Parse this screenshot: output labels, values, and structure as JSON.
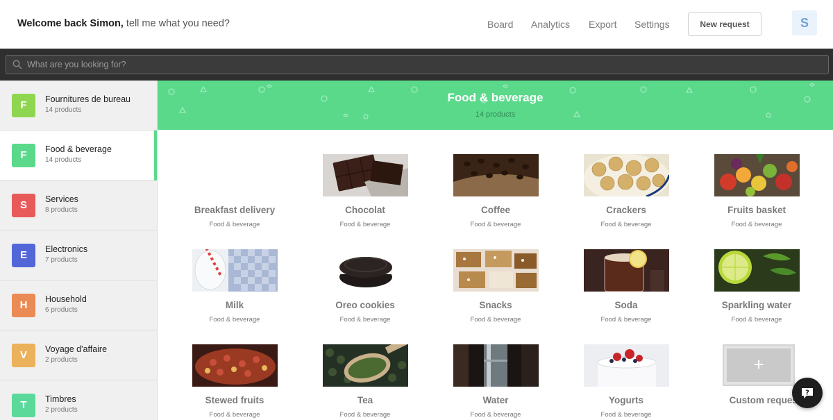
{
  "header": {
    "welcome_bold": "Welcome back Simon,",
    "welcome_rest": " tell me what you need?",
    "nav": [
      "Board",
      "Analytics",
      "Export",
      "Settings"
    ],
    "new_request_label": "New request",
    "avatar_initial": "S"
  },
  "search": {
    "placeholder": "What are you looking for?"
  },
  "sidebar": {
    "categories": [
      {
        "letter": "F",
        "name": "Fournitures de bureau",
        "count": "14 products",
        "color": "#8fd650",
        "active": false
      },
      {
        "letter": "F",
        "name": "Food & beverage",
        "count": "14 products",
        "color": "#5bd98b",
        "active": true
      },
      {
        "letter": "S",
        "name": "Services",
        "count": "8 products",
        "color": "#e85a5a",
        "active": false
      },
      {
        "letter": "E",
        "name": "Electronics",
        "count": "7 products",
        "color": "#5366d8",
        "active": false
      },
      {
        "letter": "H",
        "name": "Household",
        "count": "6 products",
        "color": "#ea8a55",
        "active": false
      },
      {
        "letter": "V",
        "name": "Voyage d'affaire",
        "count": "2 products",
        "color": "#ecb15b",
        "active": false
      },
      {
        "letter": "T",
        "name": "Timbres",
        "count": "2 products",
        "color": "#5bd99a",
        "active": false
      }
    ]
  },
  "banner": {
    "title": "Food & beverage",
    "subtitle": "14 products",
    "color": "#5bd98b"
  },
  "products": [
    {
      "name": "Breakfast delivery",
      "category": "Food & beverage",
      "image": "none"
    },
    {
      "name": "Chocolat",
      "category": "Food & beverage",
      "image": "chocolate-photo"
    },
    {
      "name": "Coffee",
      "category": "Food & beverage",
      "image": "coffee-beans-photo"
    },
    {
      "name": "Crackers",
      "category": "Food & beverage",
      "image": "crackers-photo"
    },
    {
      "name": "Fruits basket",
      "category": "Food & beverage",
      "image": "fruits-basket-photo"
    },
    {
      "name": "Milk",
      "category": "Food & beverage",
      "image": "milk-photo"
    },
    {
      "name": "Oreo cookies",
      "category": "Food & beverage",
      "image": "oreo-cookie-photo"
    },
    {
      "name": "Snacks",
      "category": "Food & beverage",
      "image": "snack-bars-photo"
    },
    {
      "name": "Soda",
      "category": "Food & beverage",
      "image": "soda-glass-photo"
    },
    {
      "name": "Sparkling water",
      "category": "Food & beverage",
      "image": "lime-water-photo"
    },
    {
      "name": "Stewed fruits",
      "category": "Food & beverage",
      "image": "stewed-fruits-photo"
    },
    {
      "name": "Tea",
      "category": "Food & beverage",
      "image": "tea-leaves-photo"
    },
    {
      "name": "Water",
      "category": "Food & beverage",
      "image": "water-bottle-photo"
    },
    {
      "name": "Yogurts",
      "category": "Food & beverage",
      "image": "yogurt-berries-photo"
    }
  ],
  "custom_request": {
    "label": "Custom request",
    "icon": "plus-icon"
  },
  "chat": {
    "icon": "chat-help-icon"
  }
}
